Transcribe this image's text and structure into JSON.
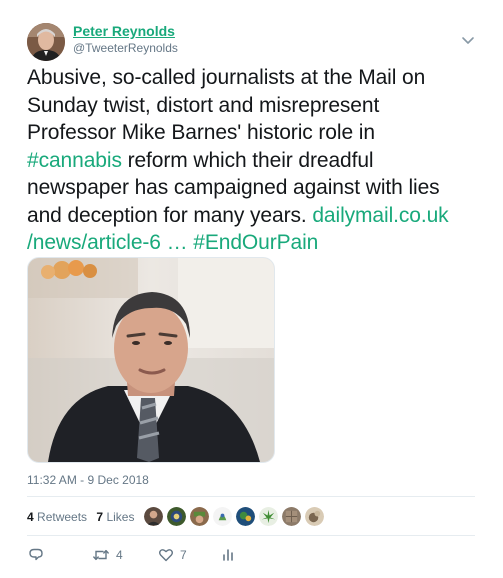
{
  "author": {
    "name": "Peter Reynolds",
    "handle": "@TweeterReynolds"
  },
  "tweet": {
    "text_line1": "Abusive, so-called journalists at the Mail on",
    "text_line2": "Sunday twist, distort and misrepresent",
    "text_line3": "Professor Mike Barnes' historic role in",
    "hashtag_cannabis": "#cannabis",
    "text_line4_rest": " reform which their dreadful",
    "text_line5": "newspaper has campaigned against with lies",
    "text_line6": "and deception for many years. ",
    "link_part1": "dailymail.co.uk",
    "link_part2": "/news/article-6  …",
    "hashtag_endourpain": "#EndOurPain"
  },
  "timestamp": "11:32 AM - 9 Dec 2018",
  "stats": {
    "retweets_count": "4",
    "retweets_label": "Retweets",
    "likes_count": "7",
    "likes_label": "Likes"
  },
  "actions": {
    "reply_count": "",
    "retweet_count": "4",
    "like_count": "7"
  },
  "colors": {
    "link": "#19a97b",
    "meta_text": "#657786",
    "primary_text": "#14171a"
  }
}
